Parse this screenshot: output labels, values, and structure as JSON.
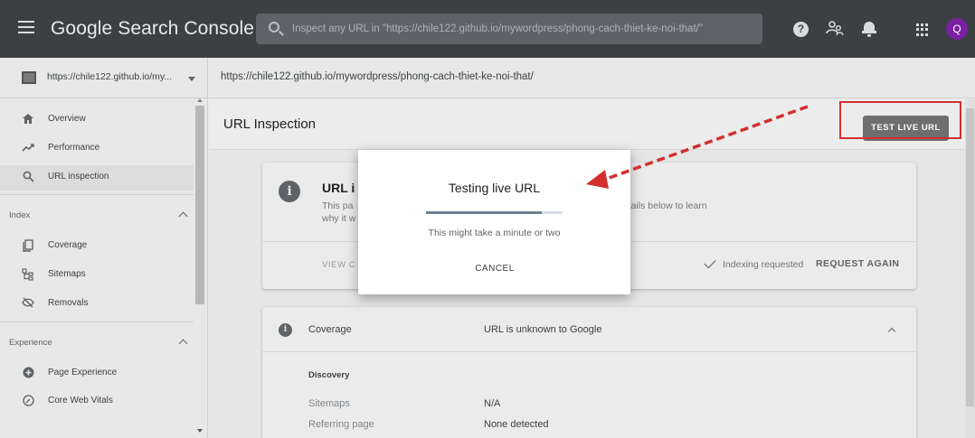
{
  "header": {
    "brand": "Google Search Console",
    "search_placeholder": "Inspect any URL in \"https://chile122.github.io/mywordpress/phong-cach-thiet-ke-noi-that/\"",
    "avatar_letter": "Q",
    "avatar_color": "#7b1fa2"
  },
  "property": {
    "label": "https://chile122.github.io/my...",
    "breadcrumb": "https://chile122.github.io/mywordpress/phong-cach-thiet-ke-noi-that/"
  },
  "sidebar": {
    "items": [
      {
        "label": "Overview",
        "icon": "home-icon"
      },
      {
        "label": "Performance",
        "icon": "trending-icon"
      },
      {
        "label": "URL inspection",
        "icon": "search-icon"
      }
    ],
    "index_section": "Index",
    "index_items": [
      {
        "label": "Coverage",
        "icon": "coverage-icon"
      },
      {
        "label": "Sitemaps",
        "icon": "sitemap-icon"
      },
      {
        "label": "Removals",
        "icon": "removals-icon"
      }
    ],
    "experience_section": "Experience",
    "experience_items": [
      {
        "label": "Page Experience",
        "icon": "page-experience-icon"
      },
      {
        "label": "Core Web Vitals",
        "icon": "gauge-icon"
      }
    ]
  },
  "main": {
    "title": "URL Inspection",
    "test_live_button": "TEST LIVE URL",
    "status_card": {
      "title": "URL i",
      "desc_line1": "This pa",
      "desc_line2": "why it w",
      "desc_right": "details below to learn",
      "view_crawled": "VIEW C",
      "indexing_status": "Indexing requested",
      "request_again": "REQUEST AGAIN"
    },
    "coverage": {
      "label": "Coverage",
      "status": "URL is unknown to Google",
      "discovery_title": "Discovery",
      "rows": [
        {
          "label": "Sitemaps",
          "value": "N/A"
        },
        {
          "label": "Referring page",
          "value": "None detected"
        }
      ]
    }
  },
  "modal": {
    "title": "Testing live URL",
    "progress_fraction": 0.85,
    "message": "This might take a minute or two",
    "cancel": "CANCEL"
  },
  "colors": {
    "annotation_red": "#d32f2f",
    "topbar": "#3c4043"
  }
}
